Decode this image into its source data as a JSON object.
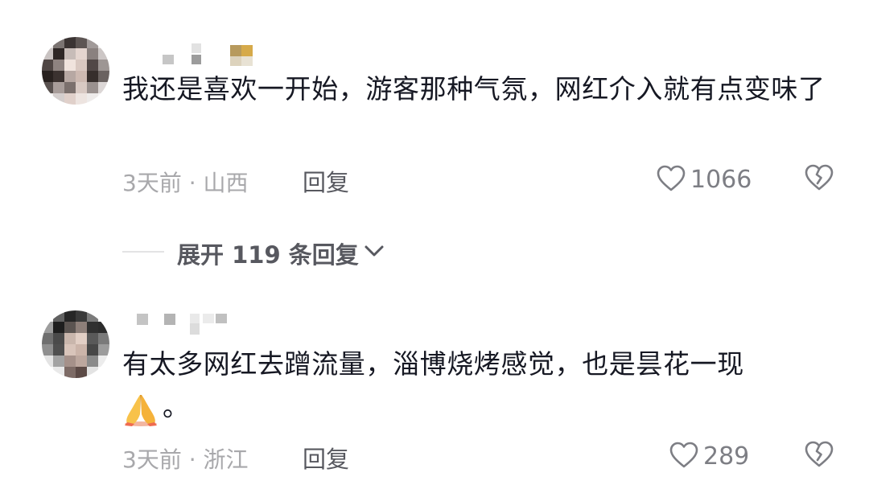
{
  "comments": [
    {
      "text": "我还是喜欢一开始，游客那种气氛，网红介入就有点变味了",
      "time": "3天前",
      "separator": "·",
      "location": "山西",
      "reply_label": "回复",
      "likes": "1066",
      "replies_toggle": "展开 119 条回复"
    },
    {
      "text": "有太多网红去蹭流量，淄博烧烤感觉，也是昙花一现",
      "emoji_suffix": "。",
      "time": "3天前",
      "separator": "·",
      "location": "浙江",
      "reply_label": "回复",
      "likes": "289"
    }
  ],
  "icons": {
    "like": "heart-outline-icon",
    "dislike": "broken-heart-icon",
    "expand": "chevron-down-icon",
    "emoji": "folded-hands-emoji"
  },
  "colors": {
    "text_primary": "#161823",
    "text_meta": "#a8a8ab",
    "text_action": "#57585f",
    "icon": "#7d7e84"
  }
}
